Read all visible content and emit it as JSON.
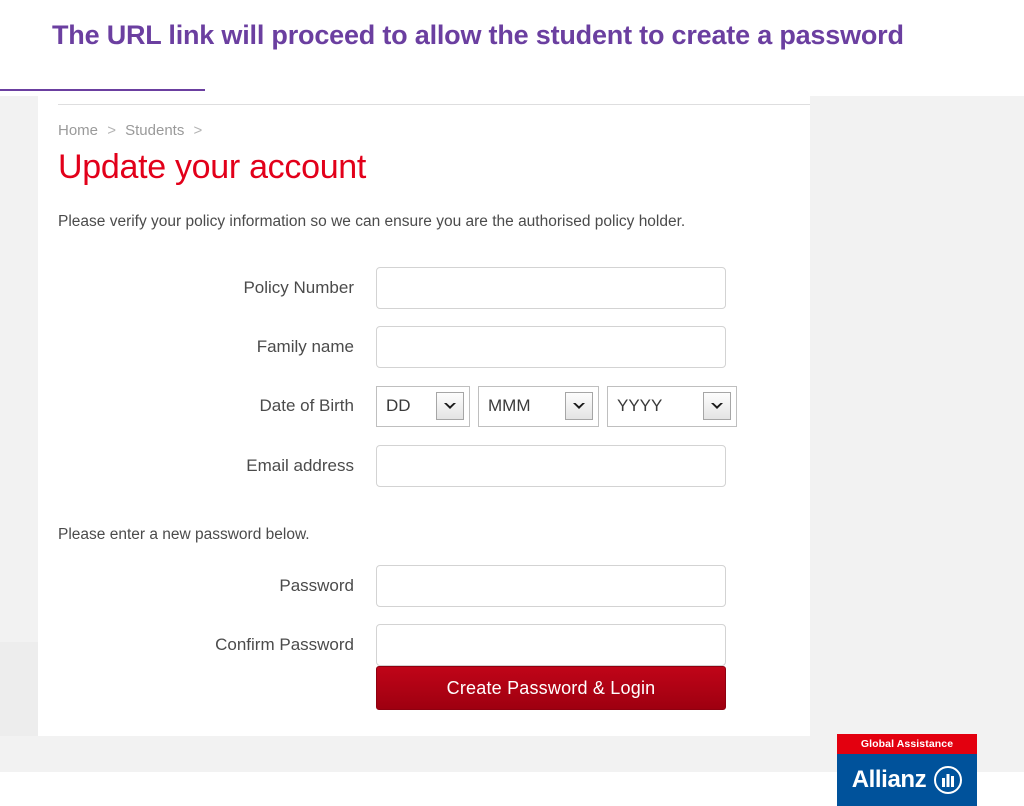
{
  "slide": {
    "title": "The URL link will proceed to allow the student to create a password",
    "title_color": "#6b3fa0"
  },
  "page": {
    "breadcrumb": {
      "items": [
        "Home",
        "Students"
      ],
      "separator": ">",
      "trailing_separator": ">"
    },
    "heading": "Update your account",
    "heading_color": "#e2001a",
    "intro_text": "Please verify your policy information so we can ensure you are the authorised policy holder.",
    "helper_text": "Please enter a new password below."
  },
  "form": {
    "fields": [
      {
        "label": "Policy Number",
        "value": "",
        "placeholder": "",
        "type": "text"
      },
      {
        "label": "Family name",
        "value": "",
        "placeholder": "",
        "type": "text"
      },
      {
        "label": "Email address",
        "value": "",
        "placeholder": "",
        "type": "text"
      },
      {
        "label": "Password",
        "value": "",
        "placeholder": "",
        "type": "password"
      },
      {
        "label": "Confirm Password",
        "value": "",
        "placeholder": "",
        "type": "password"
      }
    ],
    "date_of_birth": {
      "label": "Date of Birth",
      "day": {
        "selected": "DD"
      },
      "month": {
        "selected": "MMM"
      },
      "year": {
        "selected": "YYYY"
      }
    },
    "submit": {
      "label": "Create Password & Login",
      "color": "#b00314"
    }
  },
  "logo": {
    "top_band_text": "Global Assistance",
    "top_band_color": "#e3000f",
    "wordmark": "Allianz",
    "bottom_band_color": "#00529b"
  }
}
